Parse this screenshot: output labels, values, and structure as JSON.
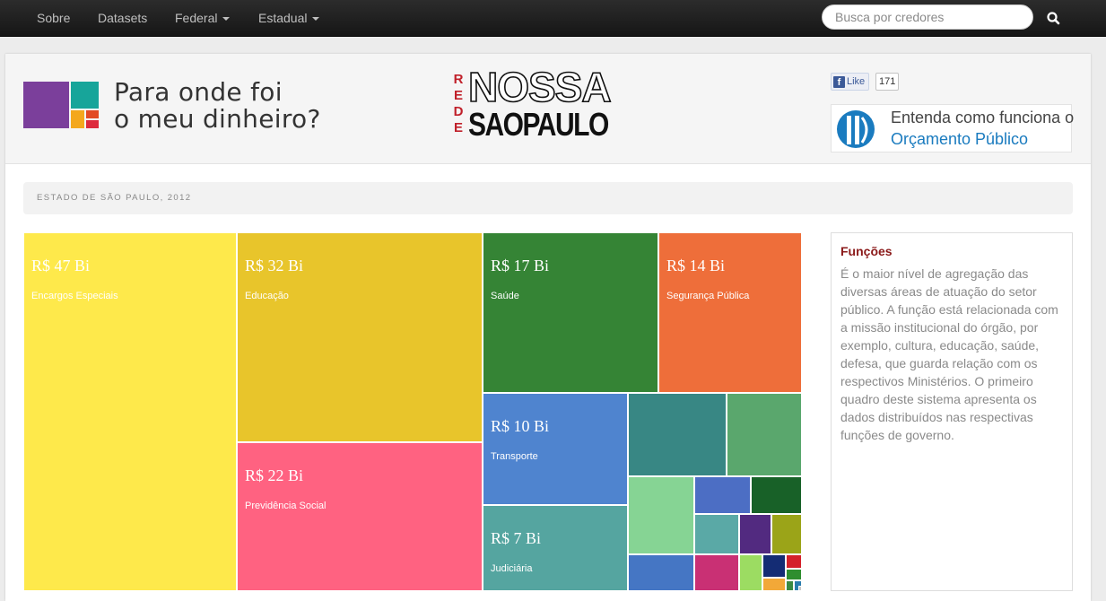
{
  "nav": {
    "items": [
      {
        "label": "Sobre",
        "dropdown": false
      },
      {
        "label": "Datasets",
        "dropdown": false
      },
      {
        "label": "Federal",
        "dropdown": true
      },
      {
        "label": "Estadual",
        "dropdown": true
      }
    ],
    "search_placeholder": "Busca por credores",
    "search_value": "",
    "search_icon": "search-icon"
  },
  "header": {
    "logo_line1": "Para onde foi",
    "logo_line2": "o meu dinheiro?",
    "rede_letters": [
      "R",
      "E",
      "D",
      "E"
    ],
    "rede_nossa": "NOSSA",
    "rede_saopaulo": "SAOPAULO",
    "fb_like_label": "Like",
    "fb_like_count": "171",
    "orcamento_line1": "Entenda como funciona o",
    "orcamento_line2": "Orçamento Público"
  },
  "breadcrumb": "ESTADO DE SÃO PAULO, 2012",
  "treemap": {
    "cells": [
      {
        "value": "R$ 47 Bi",
        "label": "Encargos Especiais",
        "color": "#fee94b"
      },
      {
        "value": "R$ 32 Bi",
        "label": "Educação",
        "color": "#e8c52b"
      },
      {
        "value": "R$ 17 Bi",
        "label": "Saúde",
        "color": "#358435"
      },
      {
        "value": "R$ 14 Bi",
        "label": "Segurança Pública",
        "color": "#ee6e3a"
      },
      {
        "value": "R$ 22 Bi",
        "label": "Previdência Social",
        "color": "#ff6281"
      },
      {
        "value": "R$ 10 Bi",
        "label": "Transporte",
        "color": "#4f84cf"
      },
      {
        "value": "R$ 7 Bi",
        "label": "Judiciária",
        "color": "#55a5a0"
      },
      {
        "value": "",
        "label": "",
        "color": "#388784"
      },
      {
        "value": "",
        "label": "",
        "color": "#5aa76d"
      },
      {
        "value": "",
        "label": "",
        "color": "#86d494"
      },
      {
        "value": "",
        "label": "",
        "color": "#4c6ec4"
      },
      {
        "value": "",
        "label": "",
        "color": "#186128"
      },
      {
        "value": "",
        "label": "",
        "color": "#5aa9a6"
      },
      {
        "value": "",
        "label": "",
        "color": "#522a80"
      },
      {
        "value": "",
        "label": "",
        "color": "#9ba418"
      },
      {
        "value": "",
        "label": "",
        "color": "#4576c4"
      },
      {
        "value": "",
        "label": "",
        "color": "#c93074"
      },
      {
        "value": "",
        "label": "",
        "color": "#9cdc62"
      },
      {
        "value": "",
        "label": "",
        "color": "#142c74"
      },
      {
        "value": "",
        "label": "",
        "color": "#d4212a"
      },
      {
        "value": "",
        "label": "",
        "color": "#2f8e2f"
      },
      {
        "value": "",
        "label": "",
        "color": "#f2a838"
      },
      {
        "value": "",
        "label": "",
        "color": "#3a8a42"
      },
      {
        "value": "",
        "label": "",
        "color": "#2a7dae"
      },
      {
        "value": "",
        "label": "",
        "color": "#c8c8c8"
      }
    ]
  },
  "sidebar": {
    "title": "Funções",
    "text": "É o maior nível de agregação das diversas áreas de atuação do setor público. A função está relacionada com a missão institucional do órgão, por exemplo, cultura, educação, saúde, defesa, que guarda relação com os respectivos Ministérios. O primeiro quadro deste sistema apresenta os dados distribuídos nas respectivas funções de governo."
  },
  "logo_colors": [
    "#7b3f9b",
    "#17a59a",
    "#f4a81d",
    "#e24b25",
    "#dd2a3c"
  ]
}
